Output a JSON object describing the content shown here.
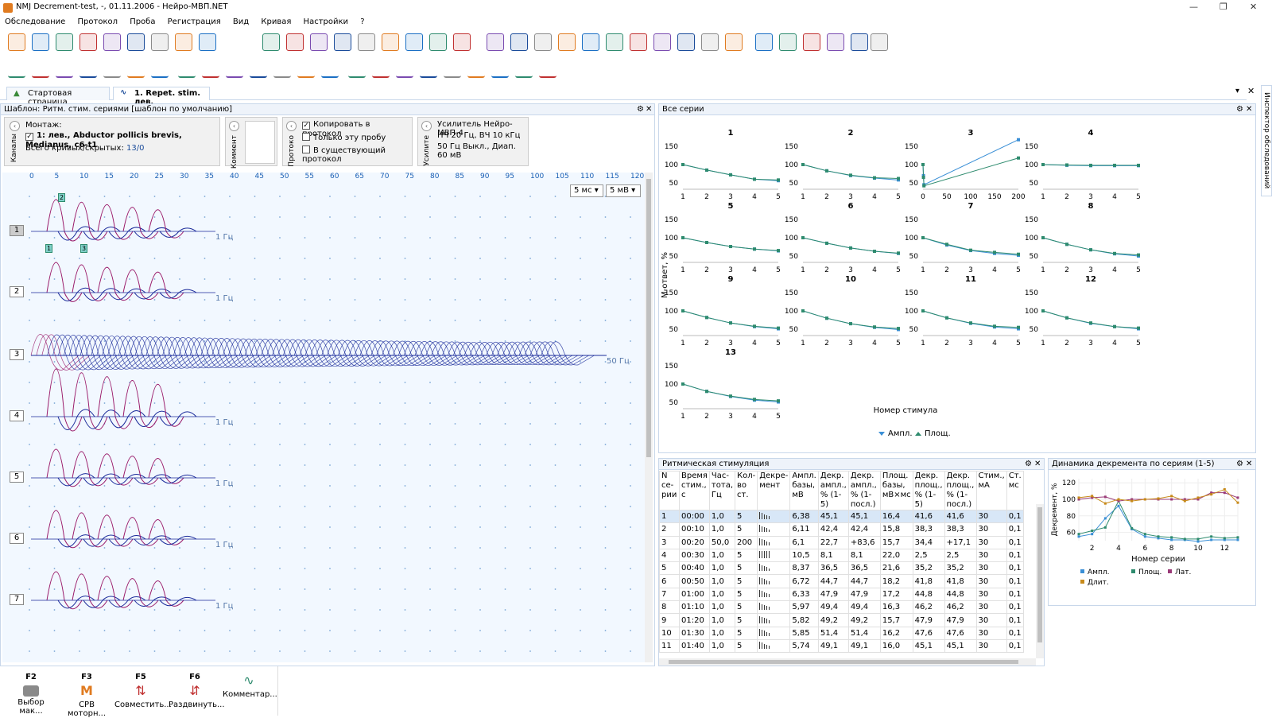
{
  "window": {
    "title": "NMJ Decrement-test, -, 01.11.2006 - Нейро-МВП.NET"
  },
  "menu": [
    "Обследование",
    "Протокол",
    "Проба",
    "Регистрация",
    "Вид",
    "Кривая",
    "Настройки",
    "?"
  ],
  "tabs": [
    {
      "label": "Стартовая страница"
    },
    {
      "label": "1. Repet. stim. лев."
    }
  ],
  "template": {
    "title": "Шаблон: Ритм. стим. сериями [шаблон по умолчанию]",
    "montage_label": "Монтаж:",
    "channel": "1: лев., Abductor pollicis brevis, Medianus, c6-t1",
    "curves_label": "Всего кривых/скрытых:",
    "curves_value": "13/0",
    "channels_vlabel": "Каналы",
    "comment_vlabel": "Коммент",
    "protocol_vlabel": "Протоко",
    "amp_vlabel": "Усилите",
    "copy_protocol": "Копировать в протокол",
    "only_this": "Только эту пробу",
    "existing_protocol": "В существующий протокол",
    "amp_name": "Усилитель Нейро-МВП-4",
    "amp_line2": "НЧ  20 Гц, ВЧ  10 кГц",
    "amp_line3": "50 Гц  Выкл., Диап. 60 мВ",
    "time_scale": "5 мс",
    "amp_scale": "5 мВ",
    "ruler": [
      "0",
      "5",
      "10",
      "15",
      "20",
      "25",
      "30",
      "35",
      "40",
      "45",
      "50",
      "55",
      "60",
      "65",
      "70",
      "75",
      "80",
      "85",
      "90",
      "95",
      "100",
      "105",
      "110",
      "115",
      "120"
    ],
    "traces": [
      {
        "n": "1",
        "hz": "1 Гц"
      },
      {
        "n": "2",
        "hz": "1 Гц"
      },
      {
        "n": "3",
        "hz": "50 Гц"
      },
      {
        "n": "4",
        "hz": "1 Гц"
      },
      {
        "n": "5",
        "hz": "1 Гц"
      },
      {
        "n": "6",
        "hz": "1 Гц"
      },
      {
        "n": "7",
        "hz": "1 Гц"
      }
    ],
    "markers": [
      "1",
      "2",
      "3"
    ]
  },
  "series_panel": {
    "title": "Все серии",
    "ylabel": "М-ответ, %",
    "xlabel": "Номер стимула",
    "legend": [
      "Ампл.",
      "Площ."
    ]
  },
  "chart_data": [
    {
      "type": "line",
      "title": "1",
      "x": [
        1,
        2,
        3,
        4,
        5
      ],
      "series": [
        {
          "name": "Ампл.",
          "values": [
            100,
            85,
            72,
            60,
            56
          ]
        },
        {
          "name": "Площ.",
          "values": [
            100,
            85,
            72,
            60,
            58
          ]
        }
      ],
      "ylim": [
        40,
        160
      ],
      "yticks": [
        50,
        100,
        150
      ]
    },
    {
      "type": "line",
      "title": "2",
      "x": [
        1,
        2,
        3,
        4,
        5
      ],
      "series": [
        {
          "name": "Ампл.",
          "values": [
            100,
            83,
            70,
            63,
            58
          ]
        },
        {
          "name": "Площ.",
          "values": [
            100,
            83,
            71,
            64,
            62
          ]
        }
      ],
      "ylim": [
        40,
        160
      ],
      "yticks": [
        50,
        100,
        150
      ]
    },
    {
      "type": "line",
      "title": "3",
      "x": [
        0,
        1,
        2,
        200
      ],
      "xticks": [
        0,
        50,
        100,
        150,
        200
      ],
      "series": [
        {
          "name": "Ампл.",
          "values": [
            100,
            70,
            45,
            168
          ]
        },
        {
          "name": "Площ.",
          "values": [
            100,
            65,
            42,
            118
          ]
        }
      ],
      "ylim": [
        40,
        160
      ],
      "yticks": [
        50,
        100,
        150
      ]
    },
    {
      "type": "line",
      "title": "4",
      "x": [
        1,
        2,
        3,
        4,
        5
      ],
      "series": [
        {
          "name": "Ампл.",
          "values": [
            100,
            98,
            97,
            97,
            97
          ]
        },
        {
          "name": "Площ.",
          "values": [
            100,
            99,
            98,
            98,
            98
          ]
        }
      ],
      "ylim": [
        40,
        160
      ],
      "yticks": [
        50,
        100,
        150
      ]
    },
    {
      "type": "line",
      "title": "5",
      "x": [
        1,
        2,
        3,
        4,
        5
      ],
      "series": [
        {
          "name": "Ампл.",
          "values": [
            100,
            87,
            76,
            69,
            64
          ]
        },
        {
          "name": "Площ.",
          "values": [
            100,
            87,
            76,
            69,
            65
          ]
        }
      ],
      "ylim": [
        40,
        160
      ],
      "yticks": [
        50,
        100,
        150
      ]
    },
    {
      "type": "line",
      "title": "6",
      "x": [
        1,
        2,
        3,
        4,
        5
      ],
      "series": [
        {
          "name": "Ампл.",
          "values": [
            100,
            85,
            72,
            63,
            57
          ]
        },
        {
          "name": "Площ.",
          "values": [
            100,
            85,
            72,
            63,
            58
          ]
        }
      ],
      "ylim": [
        40,
        160
      ],
      "yticks": [
        50,
        100,
        150
      ]
    },
    {
      "type": "line",
      "title": "7",
      "x": [
        1,
        2,
        3,
        4,
        5
      ],
      "series": [
        {
          "name": "Ампл.",
          "values": [
            100,
            80,
            65,
            57,
            52
          ]
        },
        {
          "name": "Площ.",
          "values": [
            100,
            82,
            66,
            60,
            55
          ]
        }
      ],
      "ylim": [
        40,
        160
      ],
      "yticks": [
        50,
        100,
        150
      ]
    },
    {
      "type": "line",
      "title": "8",
      "x": [
        1,
        2,
        3,
        4,
        5
      ],
      "series": [
        {
          "name": "Ампл.",
          "values": [
            100,
            82,
            67,
            56,
            50
          ]
        },
        {
          "name": "Площ.",
          "values": [
            100,
            82,
            67,
            57,
            53
          ]
        }
      ],
      "ylim": [
        40,
        160
      ],
      "yticks": [
        50,
        100,
        150
      ]
    },
    {
      "type": "line",
      "title": "9",
      "x": [
        1,
        2,
        3,
        4,
        5
      ],
      "series": [
        {
          "name": "Ампл.",
          "values": [
            100,
            82,
            67,
            57,
            51
          ]
        },
        {
          "name": "Площ.",
          "values": [
            100,
            82,
            67,
            58,
            53
          ]
        }
      ],
      "ylim": [
        40,
        160
      ],
      "yticks": [
        50,
        100,
        150
      ]
    },
    {
      "type": "line",
      "title": "10",
      "x": [
        1,
        2,
        3,
        4,
        5
      ],
      "series": [
        {
          "name": "Ампл.",
          "values": [
            100,
            80,
            65,
            55,
            49
          ]
        },
        {
          "name": "Площ.",
          "values": [
            100,
            80,
            65,
            56,
            52
          ]
        }
      ],
      "ylim": [
        40,
        160
      ],
      "yticks": [
        50,
        100,
        150
      ]
    },
    {
      "type": "line",
      "title": "11",
      "x": [
        1,
        2,
        3,
        4,
        5
      ],
      "series": [
        {
          "name": "Ампл.",
          "values": [
            100,
            81,
            66,
            56,
            51
          ]
        },
        {
          "name": "Площ.",
          "values": [
            100,
            81,
            67,
            58,
            55
          ]
        }
      ],
      "ylim": [
        40,
        160
      ],
      "yticks": [
        50,
        100,
        150
      ]
    },
    {
      "type": "line",
      "title": "12",
      "x": [
        1,
        2,
        3,
        4,
        5
      ],
      "series": [
        {
          "name": "Ампл.",
          "values": [
            100,
            81,
            66,
            57,
            51
          ]
        },
        {
          "name": "Площ.",
          "values": [
            100,
            81,
            67,
            57,
            53
          ]
        }
      ],
      "ylim": [
        40,
        160
      ],
      "yticks": [
        50,
        100,
        150
      ]
    },
    {
      "type": "line",
      "title": "13",
      "x": [
        1,
        2,
        3,
        4,
        5
      ],
      "series": [
        {
          "name": "Ампл.",
          "values": [
            100,
            80,
            66,
            56,
            51
          ]
        },
        {
          "name": "Площ.",
          "values": [
            100,
            80,
            67,
            58,
            54
          ]
        }
      ],
      "ylim": [
        40,
        160
      ],
      "yticks": [
        50,
        100,
        150
      ]
    },
    {
      "type": "line",
      "title": "",
      "xlabel": "Номер серии",
      "ylabel": "Декремент, %",
      "x": [
        1,
        2,
        3,
        4,
        5,
        6,
        7,
        8,
        9,
        10,
        11,
        12,
        13
      ],
      "xticks": [
        2,
        4,
        6,
        8,
        10,
        12
      ],
      "yticks": [
        60,
        80,
        100,
        120
      ],
      "ylim": [
        50,
        125
      ],
      "series": [
        {
          "name": "Ампл.",
          "values": [
            55,
            58,
            77,
            92,
            64,
            55,
            53,
            51,
            51,
            49,
            51,
            51,
            51
          ]
        },
        {
          "name": "Площ.",
          "values": [
            58,
            62,
            66,
            98,
            65,
            58,
            55,
            54,
            52,
            52,
            55,
            53,
            54
          ]
        },
        {
          "name": "Лат.",
          "values": [
            100,
            102,
            103,
            98,
            100,
            100,
            100,
            100,
            100,
            100,
            108,
            108,
            102
          ]
        },
        {
          "name": "Длит.",
          "values": [
            102,
            104,
            95,
            100,
            98,
            100,
            101,
            104,
            98,
            102,
            106,
            112,
            96
          ]
        }
      ]
    }
  ],
  "rhythm": {
    "title": "Ритмическая стимуляция",
    "headers": [
      "N се-рии",
      "Время стим., с",
      "Час-тота, Гц",
      "Кол-во ст.",
      "Декре-мент",
      "Ампл. базы, мВ",
      "Декр. ампл., % (1-5)",
      "Декр. ампл., % (1-посл.)",
      "Площ. базы, мВ×мс",
      "Декр. площ., % (1-5)",
      "Декр. площ., % (1-посл.)",
      "Стим., мА",
      "Ст. мс"
    ],
    "rows": [
      [
        "1",
        "00:00",
        "1,0",
        "5",
        "45,1",
        "6,38",
        "45,1",
        "16,4",
        "41,6",
        "41,6",
        "30",
        "0,1"
      ],
      [
        "2",
        "00:10",
        "1,0",
        "5",
        "42,4",
        "6,11",
        "42,4",
        "15,8",
        "38,3",
        "38,3",
        "30",
        "0,1"
      ],
      [
        "3",
        "00:20",
        "50,0",
        "200",
        "22,7",
        "6,1",
        "+83,6",
        "15,7",
        "34,4",
        "+17,1",
        "30",
        "0,1"
      ],
      [
        "4",
        "00:30",
        "1,0",
        "5",
        "8,1",
        "10,5",
        "8,1",
        "22,0",
        "2,5",
        "2,5",
        "30",
        "0,1"
      ],
      [
        "5",
        "00:40",
        "1,0",
        "5",
        "36,5",
        "8,37",
        "36,5",
        "21,6",
        "35,2",
        "35,2",
        "30",
        "0,1"
      ],
      [
        "6",
        "00:50",
        "1,0",
        "5",
        "44,7",
        "6,72",
        "44,7",
        "18,2",
        "41,8",
        "41,8",
        "30",
        "0,1"
      ],
      [
        "7",
        "01:00",
        "1,0",
        "5",
        "47,9",
        "6,33",
        "47,9",
        "17,2",
        "44,8",
        "44,8",
        "30",
        "0,1"
      ],
      [
        "8",
        "01:10",
        "1,0",
        "5",
        "49,4",
        "5,97",
        "49,4",
        "16,3",
        "46,2",
        "46,2",
        "30",
        "0,1"
      ],
      [
        "9",
        "01:20",
        "1,0",
        "5",
        "49,2",
        "5,82",
        "49,2",
        "15,7",
        "47,9",
        "47,9",
        "30",
        "0,1"
      ],
      [
        "10",
        "01:30",
        "1,0",
        "5",
        "51,4",
        "5,85",
        "51,4",
        "16,2",
        "47,6",
        "47,6",
        "30",
        "0,1"
      ],
      [
        "11",
        "01:40",
        "1,0",
        "5",
        "49,1",
        "5,74",
        "49,1",
        "16,0",
        "45,1",
        "45,1",
        "30",
        "0,1"
      ]
    ]
  },
  "dynamics": {
    "title": "Динамика декремента по сериям (1-5)",
    "xlabel": "Номер серии",
    "ylabel": "Декремент, %",
    "legend": [
      "Ампл.",
      "Площ.",
      "Лат.",
      "Длит."
    ]
  },
  "inspector": {
    "label": "Инспектор обследований"
  },
  "fkeys": [
    {
      "key": "F2",
      "label": "Выбор мак..."
    },
    {
      "key": "F3",
      "label": "СРВ моторн..."
    },
    {
      "key": "F5",
      "label": "Совместить..."
    },
    {
      "key": "F6",
      "label": "Раздвинуть..."
    },
    {
      "key": "",
      "label": "Комментар..."
    }
  ],
  "colors": {
    "accent": "#1a4b9a",
    "ampl": "#3a8fd6",
    "area": "#2e8b6e",
    "lat": "#9a3a78",
    "dur": "#c78a1a",
    "trace1": "#9a1a6a",
    "trace2": "#1a2a9a"
  }
}
